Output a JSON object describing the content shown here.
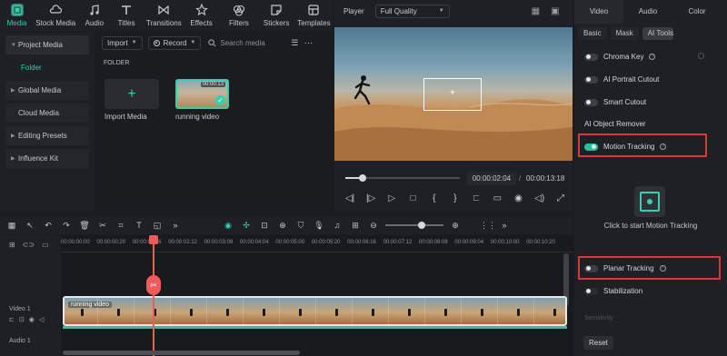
{
  "top_tabs": [
    {
      "label": "Media",
      "icon": "media-icon",
      "active": true
    },
    {
      "label": "Stock Media",
      "icon": "cloud-icon"
    },
    {
      "label": "Audio",
      "icon": "music-icon"
    },
    {
      "label": "Titles",
      "icon": "titles-icon"
    },
    {
      "label": "Transitions",
      "icon": "transitions-icon"
    },
    {
      "label": "Effects",
      "icon": "effects-icon"
    },
    {
      "label": "Filters",
      "icon": "filters-icon"
    },
    {
      "label": "Stickers",
      "icon": "stickers-icon"
    },
    {
      "label": "Templates",
      "icon": "templates-icon"
    }
  ],
  "sidebar": {
    "items": [
      {
        "label": "Project Media"
      },
      {
        "label": "Folder"
      },
      {
        "label": "Global Media"
      },
      {
        "label": "Cloud Media"
      },
      {
        "label": "Editing Presets"
      },
      {
        "label": "Influence Kit"
      }
    ]
  },
  "media": {
    "import_label": "Import",
    "record_label": "Record",
    "search_placeholder": "Search media",
    "folder_title": "FOLDER",
    "import_media_label": "Import Media",
    "video_name": "running video",
    "video_duration": "00:00:13"
  },
  "player": {
    "label": "Player",
    "quality": "Full Quality",
    "current_time": "00:00:02:04",
    "separator": "/",
    "total_time": "00:00:13:18",
    "progress": 0.15
  },
  "right_panel": {
    "tabs": [
      "Video",
      "Audio",
      "Color"
    ],
    "subtabs": [
      "Basic",
      "Mask",
      "AI Tools"
    ],
    "chroma_key": "Chroma Key",
    "ai_portrait": "AI Portrait Cutout",
    "smart_cutout": "Smart Cutout",
    "ai_object_remover": "AI Object Remover",
    "motion_tracking": "Motion Tracking",
    "click_to_start": "Click to start Motion Tracking",
    "planar_tracking": "Planar Tracking",
    "stabilization": "Stabilization",
    "sensitivity": "Sensitivity",
    "reset": "Reset"
  },
  "timeline": {
    "ticks": [
      "00:00:00:00",
      "00:00:00:20",
      "00:00:01:16",
      "00:00:02:12",
      "00:00:03:08",
      "00:00:04:04",
      "00:00:05:00",
      "00:00:05:20",
      "00:00:06:16",
      "00:00:07:12",
      "00:00:08:08",
      "00:00:09:04",
      "00:00:10:00",
      "00:00:10:20"
    ],
    "clip_label": "running video",
    "video_track": "Video 1",
    "audio_track": "Audio 1"
  },
  "colors": {
    "accent": "#31d1b0",
    "highlight_box": "#d9363e",
    "playhead": "#f05a5a"
  }
}
